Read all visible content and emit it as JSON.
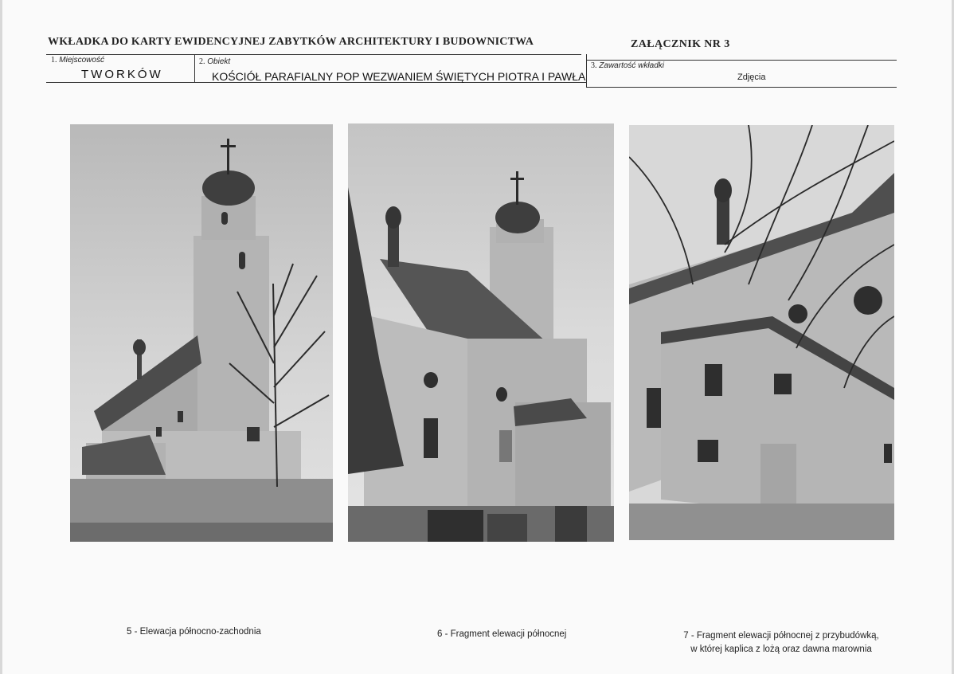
{
  "header": {
    "title": "WKŁADKA DO KARTY EWIDENCYJNEJ ZABYTKÓW ARCHITEKTURY I BUDOWNICTWA",
    "annex": "ZAŁĄCZNIK NR 3"
  },
  "fields": {
    "location": {
      "number": "1.",
      "label": "Miejscowość",
      "value": "TWORKÓW"
    },
    "object": {
      "number": "2.",
      "label": "Obiekt",
      "value": "KOŚCIÓŁ PARAFIALNY POP WEZWANIEM ŚWIĘTYCH PIOTRA I PAWŁA"
    },
    "contents": {
      "number": "3.",
      "label": "Zawartość wkładki",
      "value": "Zdjęcia"
    }
  },
  "photos": [
    {
      "caption": "5 - Elewacja północno-zachodnia"
    },
    {
      "caption": "6 - Fragment elewacji północnej"
    },
    {
      "caption_line1": "7 - Fragment elewacji północnej z przybudówką,",
      "caption_line2": "w której kaplica z lożą oraz dawna marownia"
    }
  ]
}
